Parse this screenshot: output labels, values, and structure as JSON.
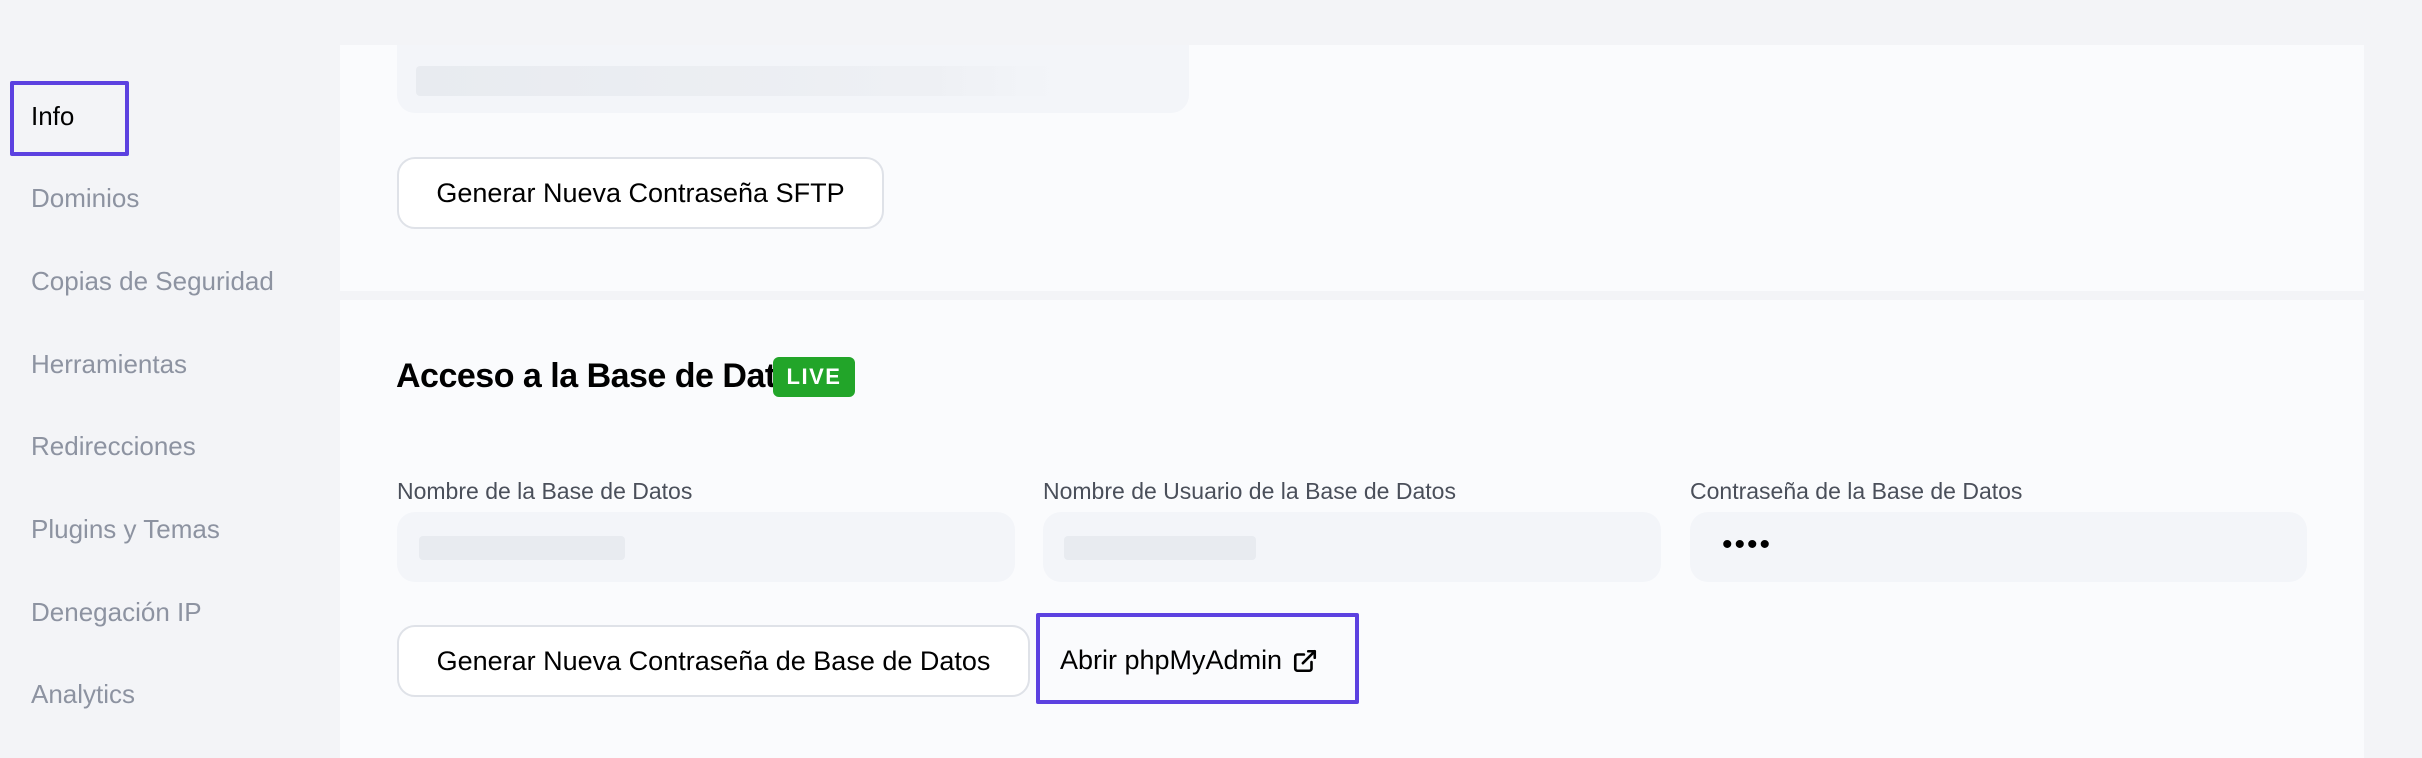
{
  "sidebar": {
    "items": [
      {
        "label": "Info",
        "active": true
      },
      {
        "label": "Dominios"
      },
      {
        "label": "Copias de Seguridad"
      },
      {
        "label": "Herramientas"
      },
      {
        "label": "Redirecciones"
      },
      {
        "label": "Plugins y Temas"
      },
      {
        "label": "Denegación IP"
      },
      {
        "label": "Analytics"
      }
    ]
  },
  "sftp": {
    "generate_button": "Generar Nueva Contraseña SFTP"
  },
  "database": {
    "title": "Acceso a la Base de Datos",
    "badge": "LIVE",
    "fields": {
      "name_label": "Nombre de la Base de Datos",
      "user_label": "Nombre de Usuario de la Base de Datos",
      "password_label": "Contraseña de la Base de Datos",
      "password_value": "••••"
    },
    "generate_button": "Generar Nueva Contraseña de Base de Datos",
    "phpmyadmin_link": "Abrir phpMyAdmin"
  },
  "colors": {
    "accent": "#5c41e0",
    "live_badge": "#22a529"
  },
  "icons": {
    "external_link": "external-link-icon"
  }
}
